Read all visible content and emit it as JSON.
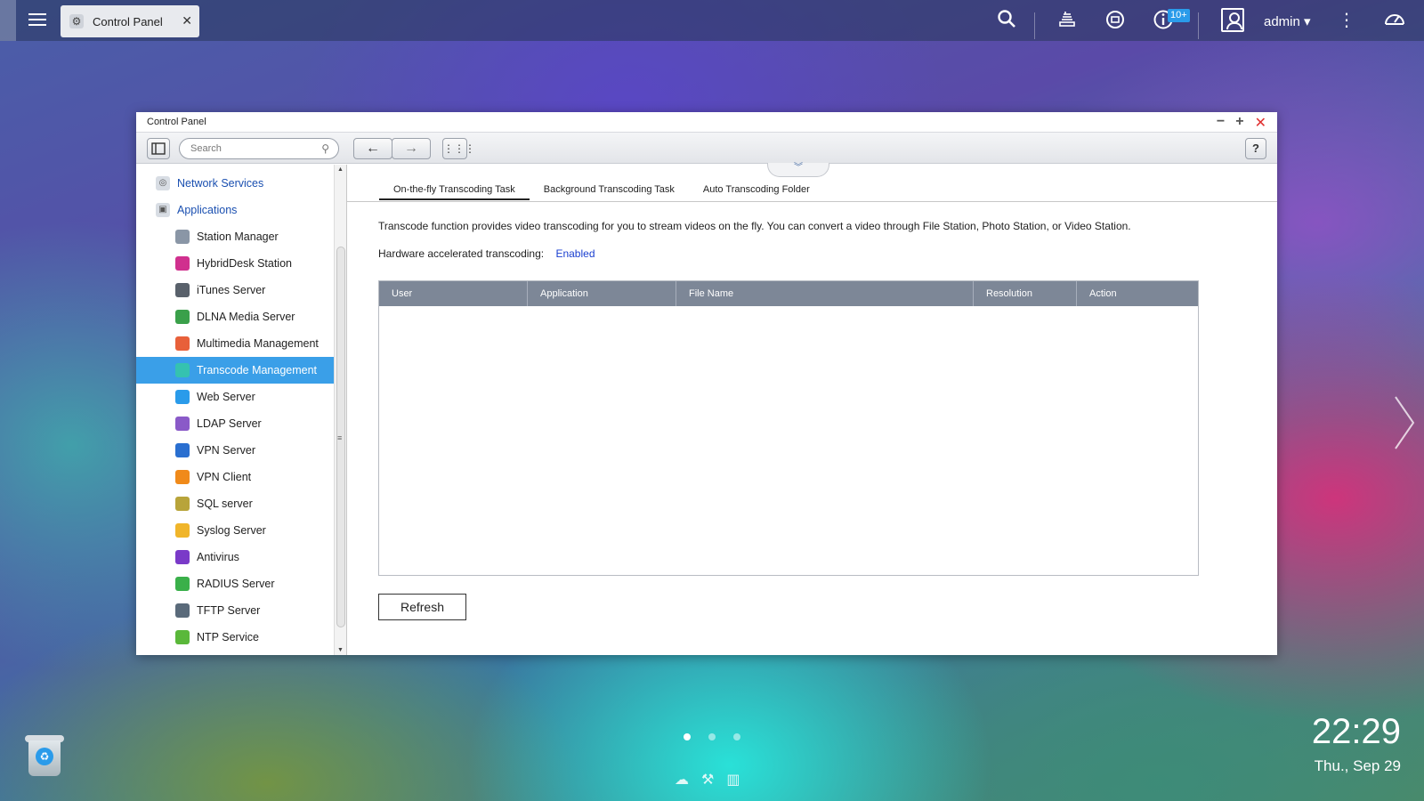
{
  "taskbar": {
    "tab_title": "Control Panel",
    "notification_count": "10+",
    "username": "admin"
  },
  "window": {
    "title": "Control Panel",
    "search_placeholder": "Search"
  },
  "sidebar": {
    "groups": [
      {
        "label": "Network Services",
        "icon": "network-services-icon"
      },
      {
        "label": "Applications",
        "icon": "applications-icon"
      }
    ],
    "items": [
      {
        "label": "Station Manager",
        "icon": "station-manager-icon",
        "color": "#8a96a6"
      },
      {
        "label": "HybridDesk Station",
        "icon": "hybriddesk-icon",
        "color": "#d0308e"
      },
      {
        "label": "iTunes Server",
        "icon": "itunes-icon",
        "color": "#59616b"
      },
      {
        "label": "DLNA Media Server",
        "icon": "dlna-icon",
        "color": "#3aa04a"
      },
      {
        "label": "Multimedia Management",
        "icon": "multimedia-icon",
        "color": "#e8603a"
      },
      {
        "label": "Transcode Management",
        "icon": "transcode-icon",
        "color": "#35c2b0"
      },
      {
        "label": "Web Server",
        "icon": "web-server-icon",
        "color": "#2a9bea"
      },
      {
        "label": "LDAP Server",
        "icon": "ldap-icon",
        "color": "#8a5ac8"
      },
      {
        "label": "VPN Server",
        "icon": "vpn-server-icon",
        "color": "#2a6fd0"
      },
      {
        "label": "VPN Client",
        "icon": "vpn-client-icon",
        "color": "#f08a1a"
      },
      {
        "label": "SQL server",
        "icon": "sql-icon",
        "color": "#b8a43a"
      },
      {
        "label": "Syslog Server",
        "icon": "syslog-icon",
        "color": "#f0b52a"
      },
      {
        "label": "Antivirus",
        "icon": "antivirus-icon",
        "color": "#7a3ac8"
      },
      {
        "label": "RADIUS Server",
        "icon": "radius-icon",
        "color": "#3ab04a"
      },
      {
        "label": "TFTP Server",
        "icon": "tftp-icon",
        "color": "#5a6a7a"
      },
      {
        "label": "NTP Service",
        "icon": "ntp-icon",
        "color": "#5ab83a"
      }
    ]
  },
  "tabs": [
    "On-the-fly Transcoding Task",
    "Background Transcoding Task",
    "Auto Transcoding Folder"
  ],
  "main": {
    "description": "Transcode function provides video transcoding for you to stream videos on the fly. You can convert a video through File Station, Photo Station, or Video Station.",
    "hw_label": "Hardware accelerated transcoding:",
    "hw_value": "Enabled",
    "columns": [
      "User",
      "Application",
      "File Name",
      "Resolution",
      "Action"
    ],
    "refresh_label": "Refresh"
  },
  "desktop": {
    "time": "22:29",
    "date": "Thu., Sep 29"
  }
}
